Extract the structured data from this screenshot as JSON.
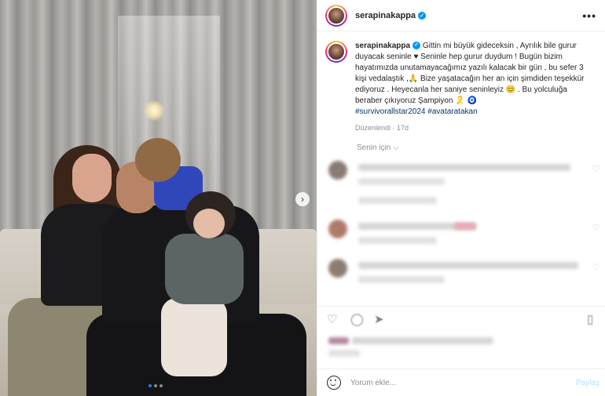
{
  "post": {
    "username": "serapinakappa",
    "verified": true,
    "more_label": "•••",
    "caption": {
      "text": "Gittin mi büyük gideceksin , Ayrılık bile gurur duyacak seninle ♥ Seninle hep gurur duydum ! Bugün bizim hayatımızda unutamayacağımız yazılı kalacak bir gün , bu sefer 3 kişi vedalaştık ,🙏 Bize yaşatacağın her an için şimdiden teşekkür ediyoruz . Heyecanla her saniye seninleyiz 😊 . Bu yolculuğa beraber çıkıyoruz Şampiyon 🎗️ 🧿",
      "hashtags": "#survivorallstar2024 #avataratakan",
      "timestamp": "Düzenlendi · 17d"
    },
    "sort_label": "Senin için ⌵",
    "comment_placeholder": "Yorum ekle...",
    "post_button": "Paylaş",
    "carousel": {
      "slides": 3,
      "active_index": 0
    },
    "next_icon": "›"
  },
  "colors": {
    "accent": "#0095f6",
    "hashtag": "#00376b",
    "muted": "#8e8e8e",
    "active_dot": "#1a7fe8"
  },
  "icons": {
    "verified": "verified-badge-icon",
    "more": "more-options-icon",
    "next": "chevron-right-icon",
    "emoji": "emoji-icon",
    "like": "heart-icon",
    "comment": "comment-icon",
    "share": "share-icon",
    "save": "bookmark-icon"
  }
}
